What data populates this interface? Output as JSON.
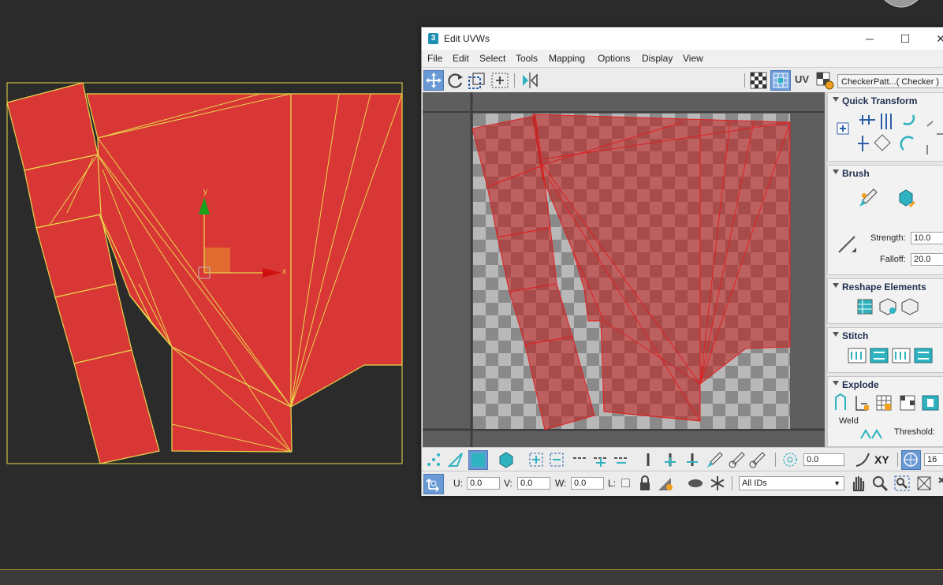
{
  "window": {
    "app_icon": "3",
    "title": "Edit UVWs",
    "minimize": "─",
    "maximize": "☐",
    "close": "✕"
  },
  "menus": [
    "File",
    "Edit",
    "Select",
    "Tools",
    "Mapping",
    "Options",
    "Display",
    "View"
  ],
  "toolbar": {
    "uv_label": "UV",
    "map_select": "CheckerPatt...( Checker )"
  },
  "viewport": {
    "axis_x": "x",
    "axis_y": "y"
  },
  "panel": {
    "quick_transform": "Quick Transform",
    "brush": "Brush",
    "strength_label": "Strength:",
    "strength_value": "10.0",
    "falloff_label": "Falloff:",
    "falloff_value": "20.0",
    "reshape": "Reshape Elements",
    "stitch": "Stitch",
    "explode": "Explode",
    "weld_label": "Weld",
    "threshold_label": "Threshold:"
  },
  "bottom": {
    "soft_value": "0.0",
    "xy_label": "XY",
    "grid_value": "16",
    "u_label": "U:",
    "u_value": "0.0",
    "v_label": "V:",
    "v_value": "0.0",
    "w_label": "W:",
    "w_value": "0.0",
    "l_label": "L:",
    "ids_value": "All IDs"
  },
  "colors": {
    "face_fill": "#d93636",
    "edge": "#e8d84a",
    "uv_edge": "#e02020",
    "active_button": "#6a9ad6",
    "icon_teal": "#2fb3c0"
  }
}
